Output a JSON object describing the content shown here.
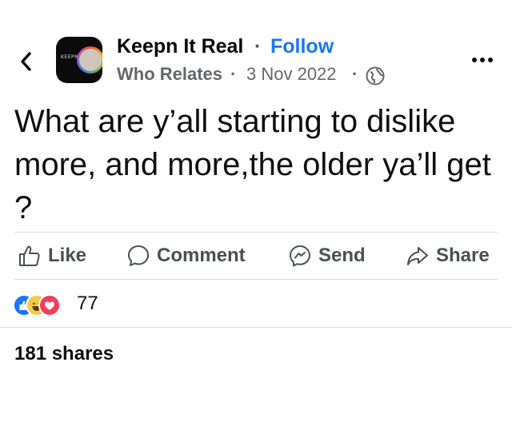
{
  "header": {
    "page_name": "Keepn It Real",
    "separator": "·",
    "follow_label": "Follow",
    "group_name": "Who Relates",
    "date": "3 Nov 2022",
    "avatar_logo_text": "KEEPN"
  },
  "post": {
    "text": "What are y’all starting to dislike more, and more,the older ya’ll get ?"
  },
  "actions": [
    {
      "label": "Like",
      "icon": "thumbs-up-icon"
    },
    {
      "label": "Comment",
      "icon": "comment-bubble-icon"
    },
    {
      "label": "Send",
      "icon": "messenger-icon"
    },
    {
      "label": "Share",
      "icon": "share-arrow-icon"
    }
  ],
  "engagement": {
    "reaction_icons": [
      "like-reaction-icon",
      "haha-reaction-icon",
      "love-reaction-icon"
    ],
    "reaction_count": "77",
    "shares_text": "181 shares"
  },
  "colors": {
    "accent": "#1877f2",
    "secondary_text": "#65676b",
    "like": "#1877f2",
    "haha": "#f7c948",
    "love": "#f33e58"
  }
}
